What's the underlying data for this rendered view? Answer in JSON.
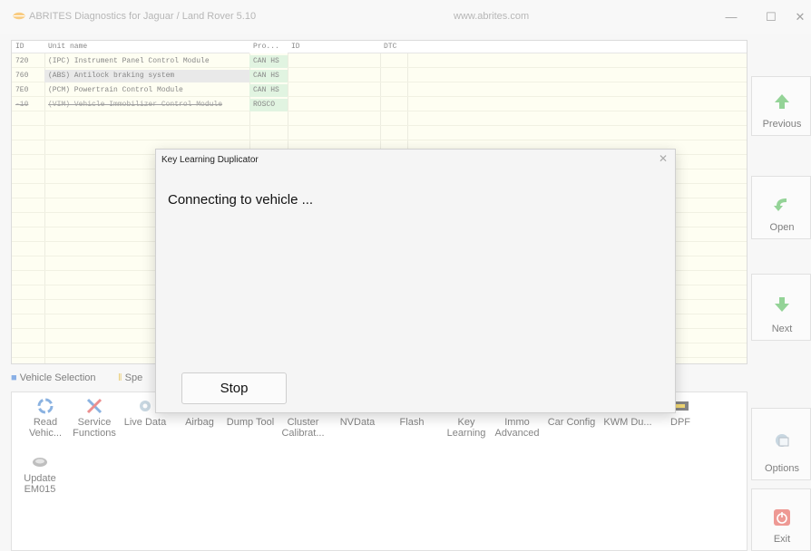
{
  "window": {
    "title": "ABRITES Diagnostics for Jaguar / Land Rover 5.10",
    "url": "www.abrites.com",
    "controls": {
      "minimize": "—",
      "maximize": "☐",
      "close": "✕"
    }
  },
  "grid": {
    "headers": {
      "id": "ID",
      "name": "Unit name",
      "protocol": "Pro...",
      "id2": "ID",
      "dtc": "DTC"
    },
    "rows": [
      {
        "id": "720",
        "name": "(IPC) Instrument Panel Control Module",
        "protocol": "CAN HS"
      },
      {
        "id": "760",
        "name": "(ABS) Antilock braking system",
        "protocol": "CAN HS"
      },
      {
        "id": "7E0",
        "name": "(PCM) Powertrain Control Module",
        "protocol": "CAN HS"
      },
      {
        "id": "-10",
        "name": "(VIM) Vehicle Immobilizer Control Module",
        "protocol": "ROSCO"
      }
    ]
  },
  "tabs": {
    "vehicle_selection": "Vehicle Selection",
    "special": "Spe"
  },
  "tools": [
    {
      "label": "Read Vehic...",
      "icon": "gear-refresh-icon"
    },
    {
      "label": "Service Functions",
      "icon": "wrench-screwdriver-icon"
    },
    {
      "label": "Live Data",
      "icon": "gear-icon"
    },
    {
      "label": "Airbag",
      "icon": ""
    },
    {
      "label": "Dump Tool",
      "icon": ""
    },
    {
      "label": "Cluster Calibrat...",
      "icon": ""
    },
    {
      "label": "NVData",
      "icon": ""
    },
    {
      "label": "Flash",
      "icon": ""
    },
    {
      "label": "Key Learning",
      "icon": ""
    },
    {
      "label": "Immo Advanced",
      "icon": ""
    },
    {
      "label": "Car Config",
      "icon": ""
    },
    {
      "label": "KWM Du...",
      "icon": ""
    },
    {
      "label": "DPF",
      "icon": "dpf-icon"
    },
    {
      "label": "Update EM015",
      "icon": "chip-icon"
    }
  ],
  "sidebar": {
    "previous": "Previous",
    "open": "Open",
    "next": "Next",
    "options": "Options",
    "exit": "Exit"
  },
  "dialog": {
    "title": "Key Learning Duplicator",
    "message": "Connecting to vehicle ...",
    "stop_label": "Stop",
    "close": "✕"
  },
  "colors": {
    "grid_bg": "#fefee8",
    "protocol_bg": "#c9ecc9",
    "arrow_green": "#3cb043",
    "exit_red": "#e0463c"
  }
}
